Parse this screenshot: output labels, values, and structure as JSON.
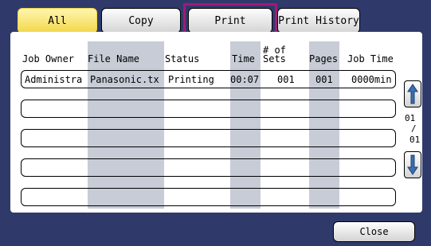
{
  "tabs": {
    "all": "All",
    "copy": "Copy",
    "print": "Print",
    "print_history": "Print History"
  },
  "columns": {
    "job_owner": "Job Owner",
    "file_name": "File Name",
    "status": "Status",
    "time": "Time",
    "sets_line1": "# of",
    "sets_line2": "Sets",
    "pages": "Pages",
    "job_time": "Job Time"
  },
  "rows": [
    {
      "job_owner": "Administra",
      "file_name": "Panasonic.tx",
      "status": "Printing",
      "time": "00:07",
      "sets": "001",
      "pages": "001",
      "job_time": "0000min"
    }
  ],
  "pagination": {
    "current": "01",
    "separator": "/",
    "total": "01"
  },
  "close_label": "Close",
  "colors": {
    "background": "#2f3a6b",
    "active_tab": "#f2d84a",
    "selected_tab_border": "#a11a76",
    "scroll_arrow": "#3a6fb0",
    "column_stripe": "#c7ccd6"
  },
  "icons": {
    "scroll_up": "up-arrow-icon",
    "scroll_down": "down-arrow-icon"
  }
}
